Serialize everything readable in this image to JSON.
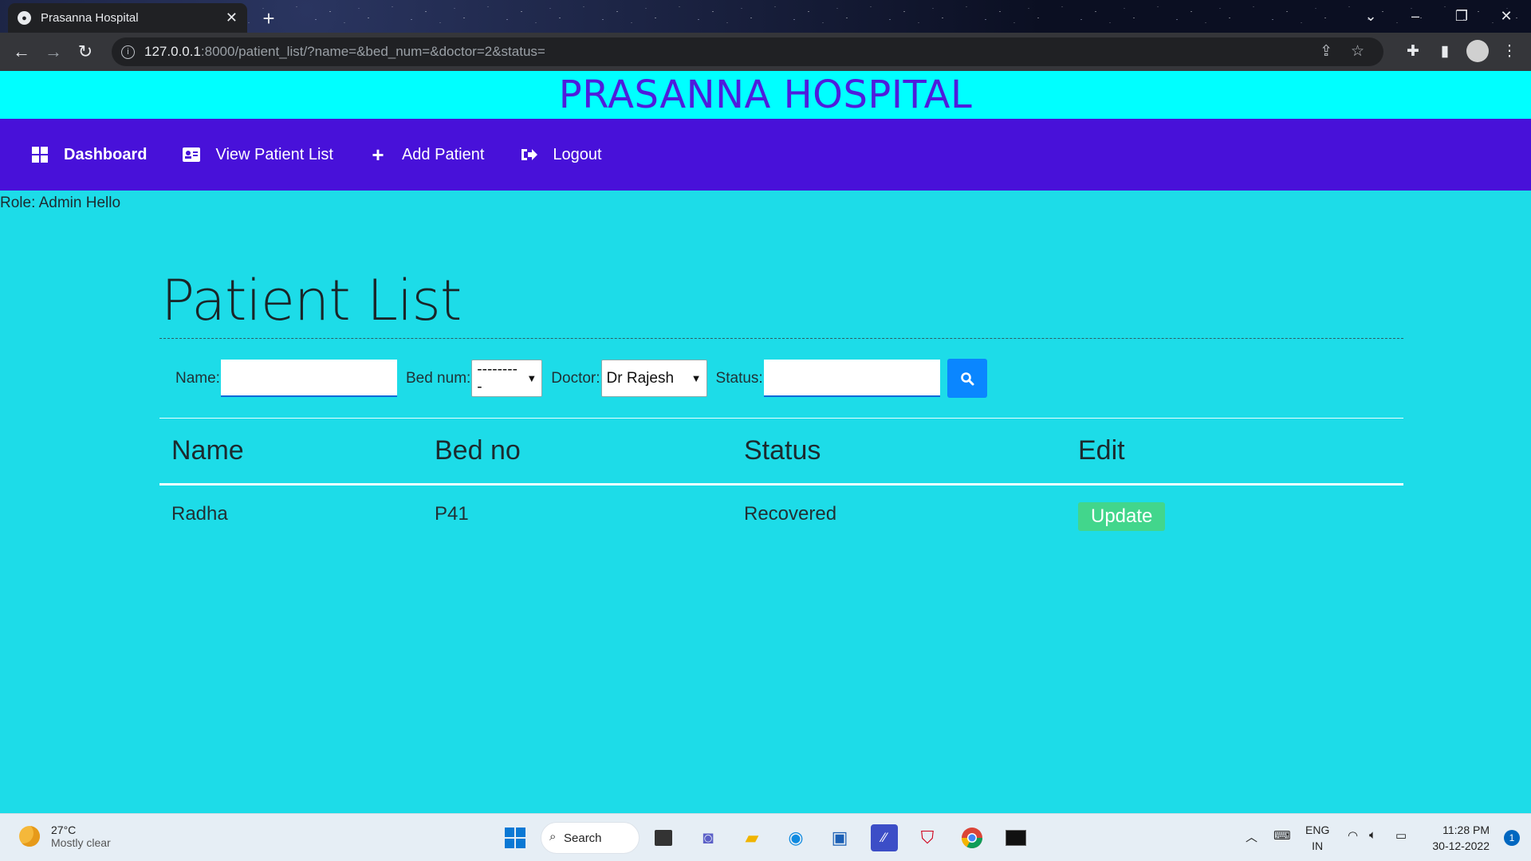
{
  "browser": {
    "tab_title": "Prasanna Hospital",
    "url_host": "127.0.0.1",
    "url_path": ":8000/patient_list/?name=&bed_num=&doctor=2&status="
  },
  "site": {
    "title": "PRASANNA HOSPITAL",
    "nav": {
      "dashboard": "Dashboard",
      "view_patients": "View Patient List",
      "add_patient": "Add Patient",
      "logout": "Logout"
    },
    "role_text": "Role: Admin Hello"
  },
  "page": {
    "title": "Patient List",
    "filters": {
      "name_label": "Name:",
      "name_value": "",
      "bed_label": "Bed num:",
      "bed_selected": "---------",
      "doctor_label": "Doctor:",
      "doctor_selected": "Dr Rajesh",
      "status_label": "Status:",
      "status_value": ""
    },
    "table": {
      "headers": [
        "Name",
        "Bed no",
        "Status",
        "Edit"
      ],
      "rows": [
        {
          "name": "Radha",
          "bed": "P41",
          "status": "Recovered",
          "action": "Update"
        }
      ]
    }
  },
  "taskbar": {
    "temp": "27°C",
    "condition": "Mostly clear",
    "search_label": "Search",
    "lang_1": "ENG",
    "lang_2": "IN",
    "time": "11:28 PM",
    "date": "30-12-2022",
    "notification_count": "1"
  },
  "colors": {
    "header_band": "#00ffff",
    "nav_bg": "#4811d9",
    "page_bg": "#1ddce8",
    "title_color": "#4f1cdc",
    "search_button": "#0a86ff",
    "update_button": "#42d68c"
  }
}
